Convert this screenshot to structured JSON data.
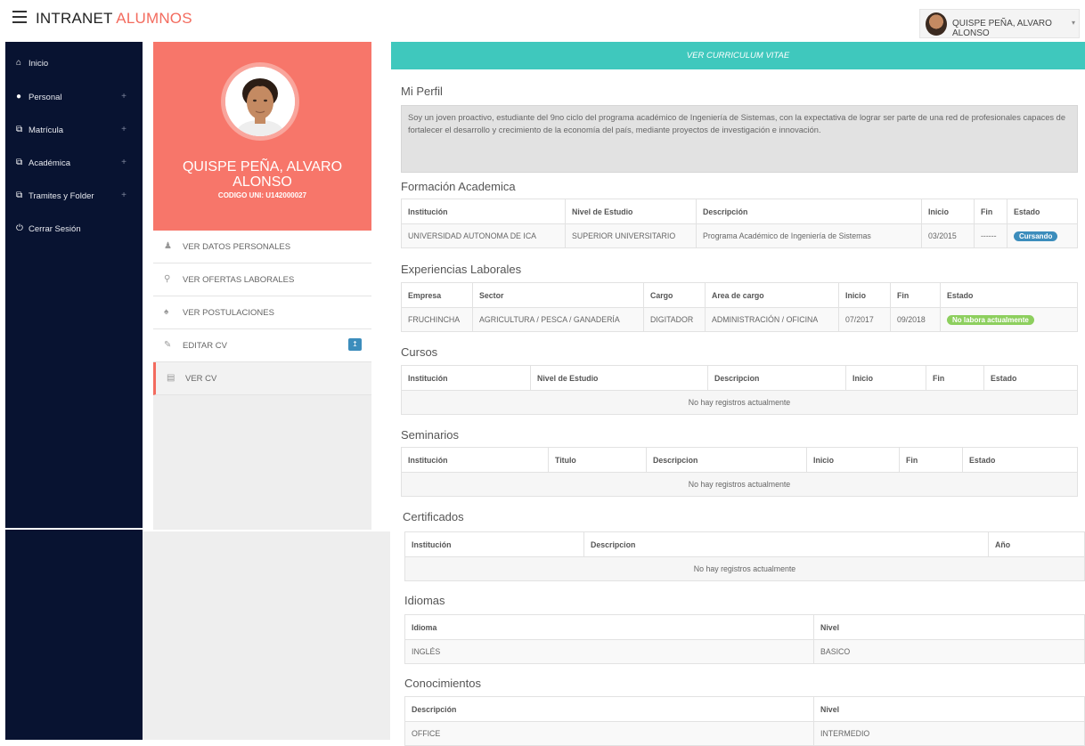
{
  "topbar": {
    "brand_main": "INTRANET",
    "brand_accent": "ALUMNOS",
    "user_name": "QUISPE PEÑA, ALVARO ALONSO",
    "accent_color": "#f36b5e"
  },
  "sidebar": {
    "items": [
      {
        "label": "Inicio",
        "icon": "home-icon",
        "has_plus": false
      },
      {
        "label": "Personal",
        "icon": "user-icon",
        "has_plus": true
      },
      {
        "label": "Matrícula",
        "icon": "external-link-icon",
        "has_plus": true
      },
      {
        "label": "Académica",
        "icon": "external-link-icon",
        "has_plus": true
      },
      {
        "label": "Tramites y Folder",
        "icon": "external-link-icon",
        "has_plus": true
      },
      {
        "label": "Cerrar Sesión",
        "icon": "power-icon",
        "has_plus": false
      }
    ],
    "plus_symbol": "+",
    "background_color": "#081331"
  },
  "profile": {
    "name": "QUISPE PEÑA, ALVARO ALONSO",
    "code": "CODIGO UNI: U142000027",
    "card_color": "#f7766a"
  },
  "menu": {
    "items": [
      {
        "label": "VER DATOS PERSONALES",
        "icon": "user-icon"
      },
      {
        "label": "VER OFERTAS LABORALES",
        "icon": "search-icon"
      },
      {
        "label": "VER POSTULACIONES",
        "icon": "bell-icon"
      },
      {
        "label": "EDITAR CV",
        "icon": "edit-icon",
        "badge": "↥"
      },
      {
        "label": "VER CV",
        "icon": "book-icon"
      }
    ]
  },
  "main": {
    "cv_button": "VER CURRICULUM VITAE",
    "perfil_title": "Mi Perfil",
    "perfil_text": "Soy un joven proactivo, estudiante del 9no ciclo del programa académico de Ingeniería de Sistemas, con la expectativa de lograr ser parte de una red de profesionales capaces de fortalecer el desarrollo y crecimiento de la economía del país, mediante proyectos de investigación e innovación.",
    "formacion": {
      "title": "Formación Academica",
      "headers": [
        "Institución",
        "Nivel de Estudio",
        "Descripción",
        "Inicio",
        "Fin",
        "Estado"
      ],
      "rows": [
        [
          "UNIVERSIDAD AUTONOMA DE ICA",
          "SUPERIOR UNIVERSITARIO",
          "Programa Académico de Ingeniería de Sistemas",
          "03/2015",
          "------",
          "Cursando"
        ]
      ]
    },
    "experiencias": {
      "title": "Experiencias Laborales",
      "headers": [
        "Empresa",
        "Sector",
        "Cargo",
        "Area de cargo",
        "Inicio",
        "Fin",
        "Estado"
      ],
      "rows": [
        [
          "FRUCHINCHA",
          "AGRICULTURA / PESCA / GANADERÍA",
          "DIGITADOR",
          "ADMINISTRACIÓN / OFICINA",
          "07/2017",
          "09/2018",
          "No labora actualmente"
        ]
      ]
    },
    "cursos": {
      "title": "Cursos",
      "headers": [
        "Institución",
        "Nivel de Estudio",
        "Descripcion",
        "Inicio",
        "Fin",
        "Estado"
      ],
      "empty": "No hay registros actualmente"
    },
    "seminarios": {
      "title": "Seminarios",
      "headers": [
        "Institución",
        "Titulo",
        "Descripcion",
        "Inicio",
        "Fin",
        "Estado"
      ],
      "empty": "No hay registros actualmente"
    },
    "certificados": {
      "title": "Certificados",
      "headers": [
        "Institución",
        "Descripcion",
        "Año"
      ],
      "empty": "No hay registros actualmente"
    },
    "idiomas": {
      "title": "Idiomas",
      "headers": [
        "Idioma",
        "Nivel"
      ],
      "rows": [
        [
          "INGLÉS",
          "BASICO"
        ]
      ]
    },
    "conocimientos": {
      "title": "Conocimientos",
      "headers": [
        "Descripción",
        "Nivel"
      ],
      "rows": [
        [
          "OFFICE",
          "INTERMEDIO"
        ]
      ]
    },
    "colors": {
      "cv_bar": "#3fc8bd",
      "status_blue": "#3c8dbc",
      "status_green": "#8dcf5e"
    }
  }
}
